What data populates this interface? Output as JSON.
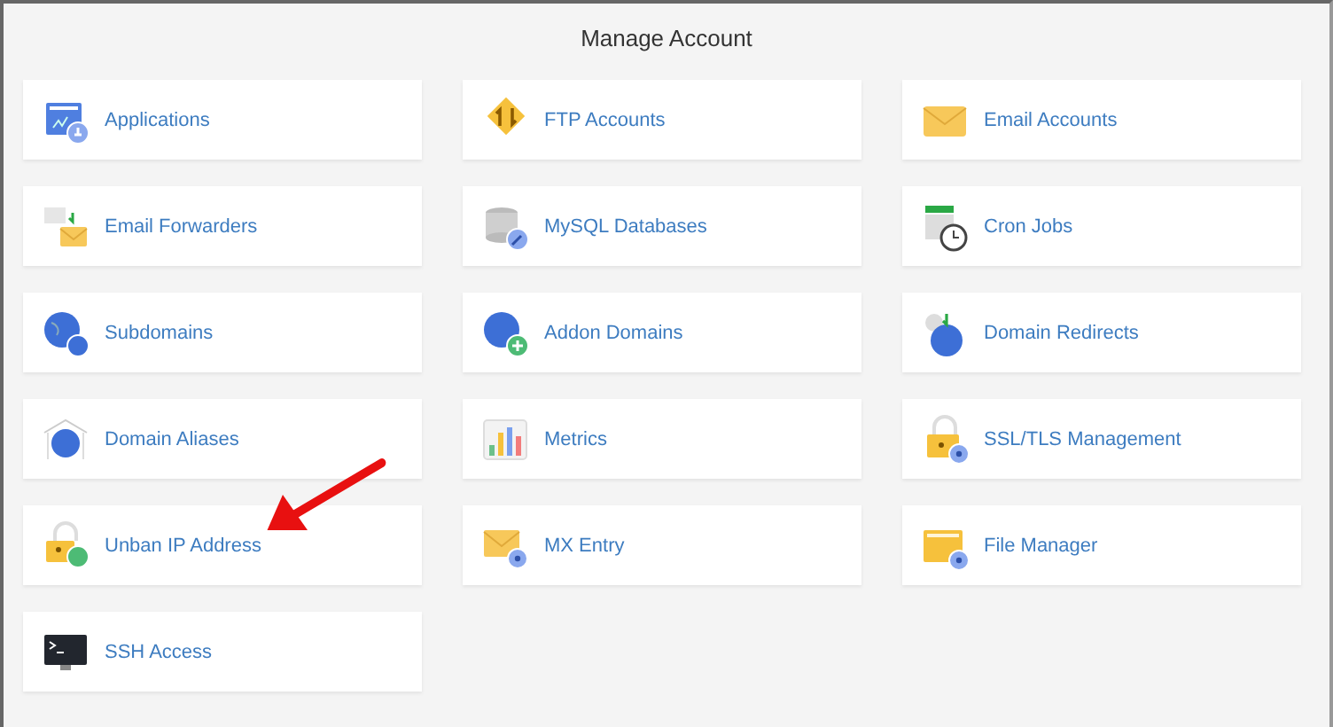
{
  "title": "Manage Account",
  "items": [
    {
      "label": "Applications",
      "pointed": false
    },
    {
      "label": "FTP Accounts",
      "pointed": false
    },
    {
      "label": "Email Accounts",
      "pointed": false
    },
    {
      "label": "Email Forwarders",
      "pointed": false
    },
    {
      "label": "MySQL Databases",
      "pointed": false
    },
    {
      "label": "Cron Jobs",
      "pointed": false
    },
    {
      "label": "Subdomains",
      "pointed": false
    },
    {
      "label": "Addon Domains",
      "pointed": false
    },
    {
      "label": "Domain Redirects",
      "pointed": false
    },
    {
      "label": "Domain Aliases",
      "pointed": false
    },
    {
      "label": "Metrics",
      "pointed": false
    },
    {
      "label": "SSL/TLS Management",
      "pointed": false
    },
    {
      "label": "Unban IP Address",
      "pointed": true
    },
    {
      "label": "MX Entry",
      "pointed": false
    },
    {
      "label": "File Manager",
      "pointed": false
    },
    {
      "label": "SSH Access",
      "pointed": false
    }
  ]
}
